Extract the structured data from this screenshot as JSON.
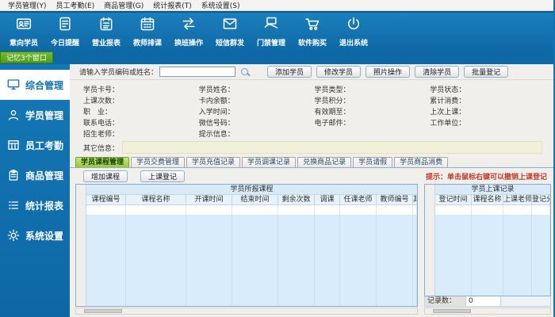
{
  "menubar": {
    "items": [
      "学员管理(Y)",
      "员工考勤(E)",
      "商品管理(G)",
      "统计报表(T)",
      "系统设置(S)"
    ]
  },
  "toolbar": {
    "items": [
      {
        "label": "意向学员",
        "icon": "id-card-icon"
      },
      {
        "label": "今日提醒",
        "icon": "reminder-icon"
      },
      {
        "label": "营业报表",
        "icon": "report-icon"
      },
      {
        "label": "教师排课",
        "icon": "calendar-icon"
      },
      {
        "label": "换班操作",
        "icon": "swap-icon"
      },
      {
        "label": "短信群发",
        "icon": "sms-icon"
      },
      {
        "label": "门禁管理",
        "icon": "door-access-icon"
      },
      {
        "label": "软件购买",
        "icon": "cart-icon"
      },
      {
        "label": "退出系统",
        "icon": "power-icon"
      }
    ]
  },
  "quickbar": {
    "badge": "记忆3个窗口"
  },
  "sidebar": {
    "items": [
      {
        "label": "综合管理",
        "icon": "monitor-icon",
        "selected": true
      },
      {
        "label": "学员管理",
        "icon": "person-icon",
        "selected": false
      },
      {
        "label": "员工考勤",
        "icon": "attendance-icon",
        "selected": false
      },
      {
        "label": "商品管理",
        "icon": "goods-icon",
        "selected": false
      },
      {
        "label": "统计报表",
        "icon": "stats-icon",
        "selected": false
      },
      {
        "label": "系统设置",
        "icon": "gear-icon",
        "selected": false
      }
    ]
  },
  "search": {
    "label": "请输入学员编码或姓名：",
    "value": "",
    "icon": "search-icon"
  },
  "actions": {
    "buttons": [
      "添加学员",
      "修改学员",
      "照片操作",
      "清除学员",
      "批量登记"
    ]
  },
  "member_form": {
    "rows": [
      [
        "学员卡号：",
        "学员姓名：",
        "学员类型：",
        "学员状态："
      ],
      [
        "上课次数：",
        "卡内余额：",
        "学员积分：",
        "累计消费："
      ],
      [
        "职　业：",
        "入学时间：",
        "有效期至：",
        "上次上课："
      ],
      [
        "联系电话：",
        "微信号码：",
        "电子邮件：",
        "工作单位："
      ],
      [
        "招生老师：",
        "提示信息：",
        "",
        ""
      ]
    ],
    "other_label": "其它信息：",
    "other_value": ""
  },
  "tabs": [
    {
      "label": "学员课程管理",
      "selected": true
    },
    {
      "label": "学员交费管理",
      "selected": false
    },
    {
      "label": "学员充值记录",
      "selected": false
    },
    {
      "label": "学员调课记录",
      "selected": false
    },
    {
      "label": "兑换商品记录",
      "selected": false
    },
    {
      "label": "学员请假",
      "selected": false
    },
    {
      "label": "学员商品消费",
      "selected": false
    }
  ],
  "course_panel": {
    "buttons": [
      "增加课程",
      "上课登记"
    ],
    "table": {
      "title": "学员所报课程",
      "columns": [
        "课程编号",
        "课程名称",
        "开课时间",
        "结束时间",
        "剩余次数",
        "调课",
        "任课老师",
        "教师编号",
        "其它信息"
      ],
      "rows": []
    }
  },
  "attendance_panel": {
    "hint": "提示：单击鼠标右键可以撤销上课登记",
    "table": {
      "title": "学员上课记录",
      "columns": [
        "登记时间",
        "课程名称",
        "上课老师",
        "登记分校"
      ],
      "rows": []
    },
    "footer": {
      "label": "记录数：",
      "value": "0"
    }
  },
  "colors": {
    "toolbar_blue": "#1173b0",
    "sidebar_blue": "#1173b0",
    "badge_green": "#5fa91d",
    "tab_selected_green": "#96c93d",
    "hint_red": "#c3392c",
    "table_header_blue": "#e7f2fb",
    "table_body_blue": "#d9ecfb"
  }
}
